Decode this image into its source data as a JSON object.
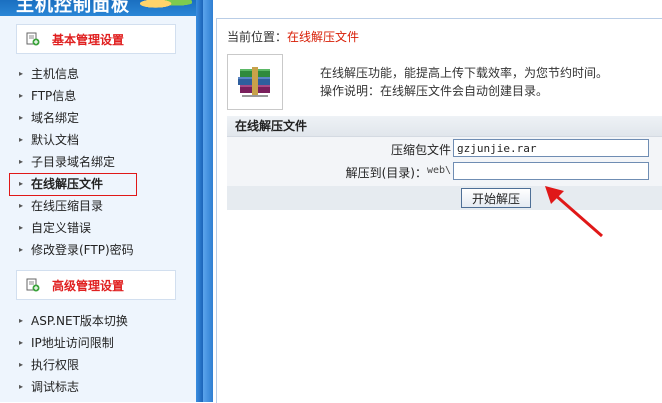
{
  "header": {
    "title": "主机控制面板"
  },
  "sidebar": {
    "sections": [
      {
        "title": "基本管理设置",
        "items": [
          {
            "label": "主机信息"
          },
          {
            "label": "FTP信息"
          },
          {
            "label": "域名绑定"
          },
          {
            "label": "默认文档"
          },
          {
            "label": "子目录域名绑定"
          },
          {
            "label": "在线解压文件",
            "active": true
          },
          {
            "label": "在线压缩目录"
          },
          {
            "label": "自定义错误"
          },
          {
            "label": "修改登录(FTP)密码"
          }
        ]
      },
      {
        "title": "高级管理设置",
        "items": [
          {
            "label": "ASP.NET版本切换"
          },
          {
            "label": "IP地址访问限制"
          },
          {
            "label": "执行权限"
          },
          {
            "label": "调试标志"
          }
        ]
      }
    ]
  },
  "main": {
    "breadcrumb_prefix": "当前位置：",
    "breadcrumb_current": "在线解压文件",
    "description_line1": "在线解压功能，能提高上传下载效率，为您节约时间。",
    "description_line2": "操作说明：在线解压文件会自动创建目录。",
    "panel_title": "在线解压文件",
    "archive_label": "压缩包文件：",
    "archive_value": "gzjunjie.rar",
    "extract_label": "解压到(目录)：",
    "extract_prefix": "web\\",
    "extract_value": "",
    "required_mark": "*",
    "start_button": "开始解压"
  },
  "colors": {
    "accent_red": "#d81e06",
    "sidebar_bg": "#eef5fd",
    "frame_blue": "#2a78cc"
  }
}
